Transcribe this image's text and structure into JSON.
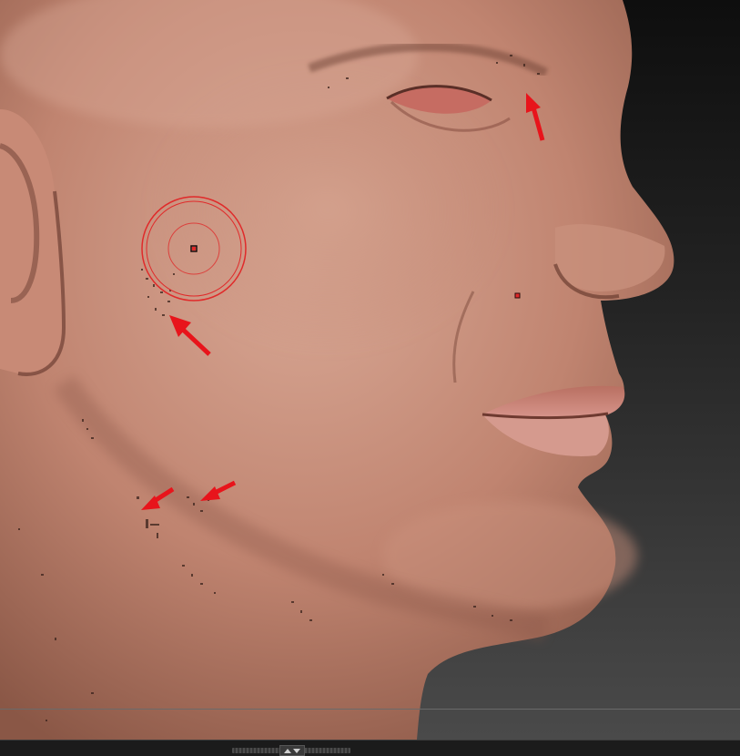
{
  "colors": {
    "skin_base": "#c08470",
    "skin_highlight": "#d9a996",
    "skin_shadow": "#8a5746",
    "brush_cursor": "#e02a2a",
    "annotation_arrow": "#e8141b",
    "viewport_bg_top": "#0e0e0e",
    "viewport_bg_bottom": "#4a4a4a",
    "bottom_bar": "#1b1b1b"
  },
  "icons": {
    "tray_toggle": "up-down-triangles-icon"
  }
}
